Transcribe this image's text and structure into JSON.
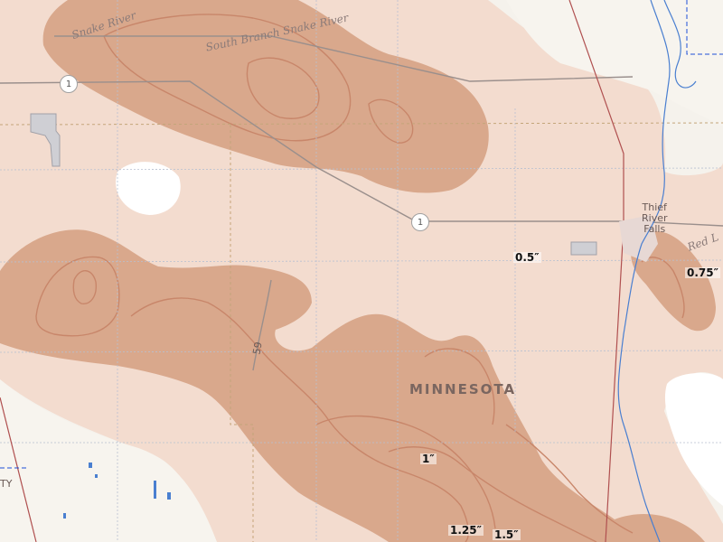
{
  "map": {
    "state_label": "MINNESOTA",
    "city_label": "Thief\nRiver\nFalls",
    "county_label_fragment": "TY",
    "rivers": {
      "snake": "Snake River",
      "south_branch": "South Branch Snake River",
      "red": "Red L"
    },
    "road_shields": [
      "1",
      "1",
      "59"
    ],
    "contours": [
      "0.5″",
      "0.75″",
      "1″",
      "1.25″",
      "1.5″"
    ],
    "colors": {
      "background": "#f5f2ec",
      "band_light": "#f3dccf",
      "band_medium": "#d9a88c",
      "contour_line": "#c8866a",
      "water": "#4a7fd0",
      "railroad": "#b05050"
    }
  }
}
